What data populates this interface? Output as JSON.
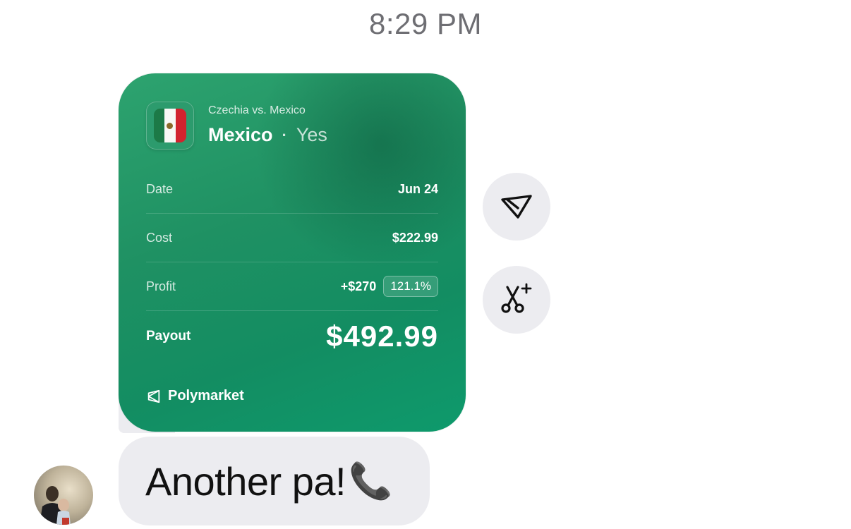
{
  "timestamp": "8:29 PM",
  "card": {
    "match": "Czechia vs. Mexico",
    "pick_team": "Mexico",
    "separator": "·",
    "pick_outcome": "Yes",
    "rows": [
      {
        "label": "Date",
        "value": "Jun 24"
      },
      {
        "label": "Cost",
        "value": "$222.99"
      },
      {
        "label": "Profit",
        "value": "+$270",
        "badge": "121.1%"
      }
    ],
    "payout_label": "Payout",
    "payout_value": "$492.99",
    "brand": "Polymarket"
  },
  "actions": [
    {
      "name": "filter-icon"
    },
    {
      "name": "magic-scissors-icon"
    }
  ],
  "message": {
    "text": "Another pa!",
    "emoji": "📞"
  },
  "colors": {
    "card_green": "#1f9163",
    "bubble_gray": "#ececf0"
  }
}
